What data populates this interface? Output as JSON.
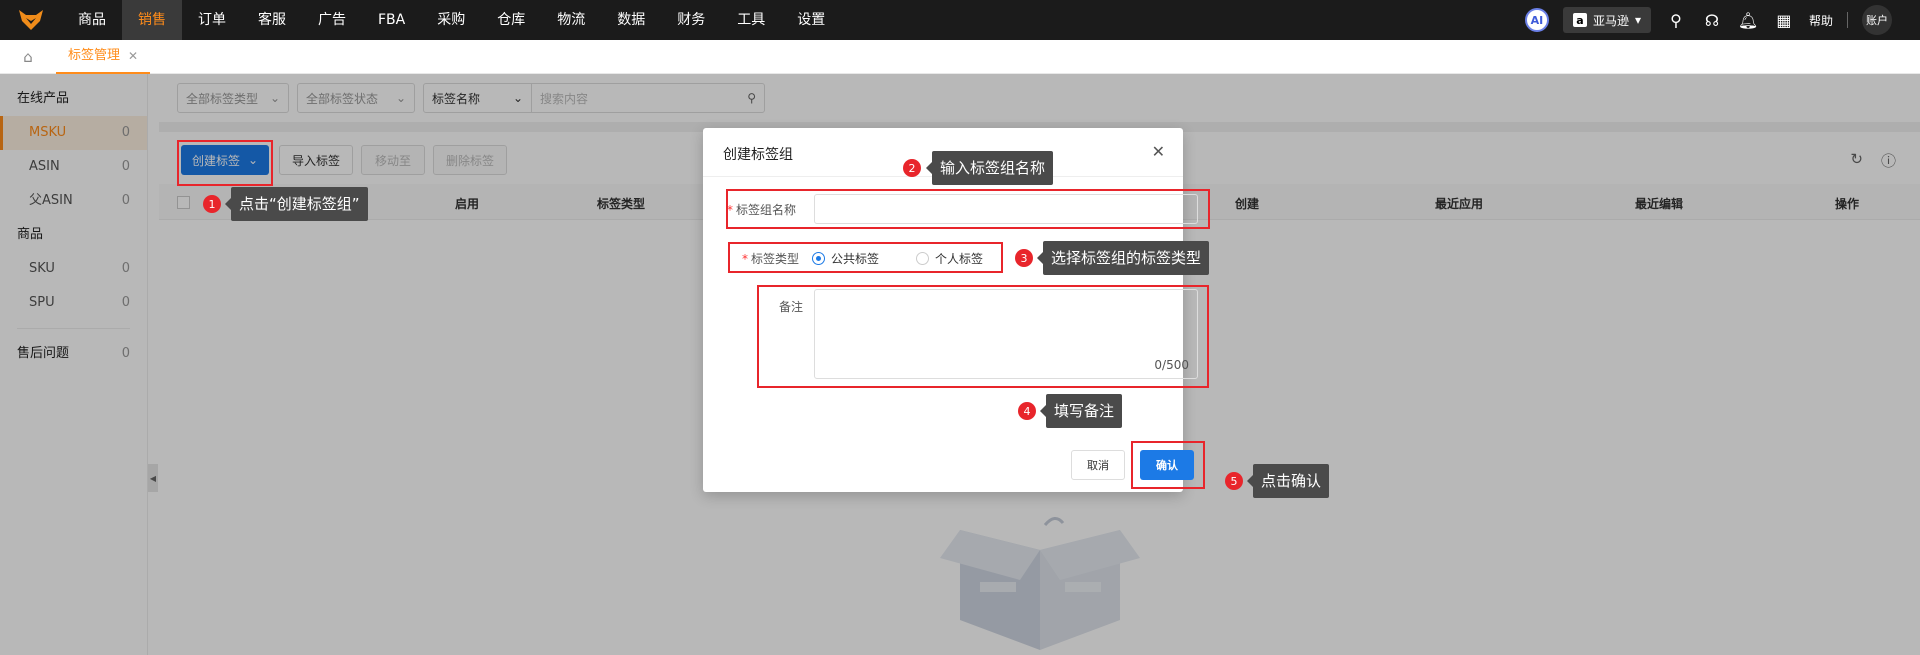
{
  "nav": {
    "items": [
      "商品",
      "销售",
      "订单",
      "客服",
      "广告",
      "FBA",
      "采购",
      "仓库",
      "物流",
      "数据",
      "财务",
      "工具",
      "设置"
    ],
    "active_index": 1,
    "ai": "AI",
    "store": "亚马逊",
    "help": "帮助",
    "account": "账户"
  },
  "tabs": [
    {
      "label": "标签管理"
    }
  ],
  "sidebar": {
    "group1": "在线产品",
    "items1": [
      {
        "label": "MSKU",
        "count": "0"
      },
      {
        "label": "ASIN",
        "count": "0"
      },
      {
        "label": "父ASIN",
        "count": "0"
      }
    ],
    "group2": "商品",
    "items2": [
      {
        "label": "SKU",
        "count": "0"
      },
      {
        "label": "SPU",
        "count": "0"
      }
    ],
    "after_sales": {
      "label": "售后问题",
      "count": "0"
    }
  },
  "filters": {
    "tag_type": "全部标签类型",
    "tag_status": "全部标签状态",
    "search_field": "标签名称",
    "search_placeholder": "搜索内容"
  },
  "toolbar": {
    "create": "创建标签",
    "import": "导入标签",
    "move": "移动至",
    "delete": "删除标签"
  },
  "table": {
    "columns": [
      "启用",
      "标签类型",
      "创建",
      "最近应用",
      "最近编辑",
      "操作"
    ]
  },
  "modal": {
    "title": "创建标签组",
    "name_label": "标签组名称",
    "type_label": "标签类型",
    "type_public": "公共标签",
    "type_private": "个人标签",
    "note_label": "备注",
    "note_count": "0/500",
    "cancel": "取消",
    "confirm": "确认"
  },
  "annotations": [
    {
      "num": "1",
      "text": "点击“创建标签组”"
    },
    {
      "num": "2",
      "text": "输入标签组名称"
    },
    {
      "num": "3",
      "text": "选择标签组的标签类型"
    },
    {
      "num": "4",
      "text": "填写备注"
    },
    {
      "num": "5",
      "text": "点击确认"
    }
  ]
}
